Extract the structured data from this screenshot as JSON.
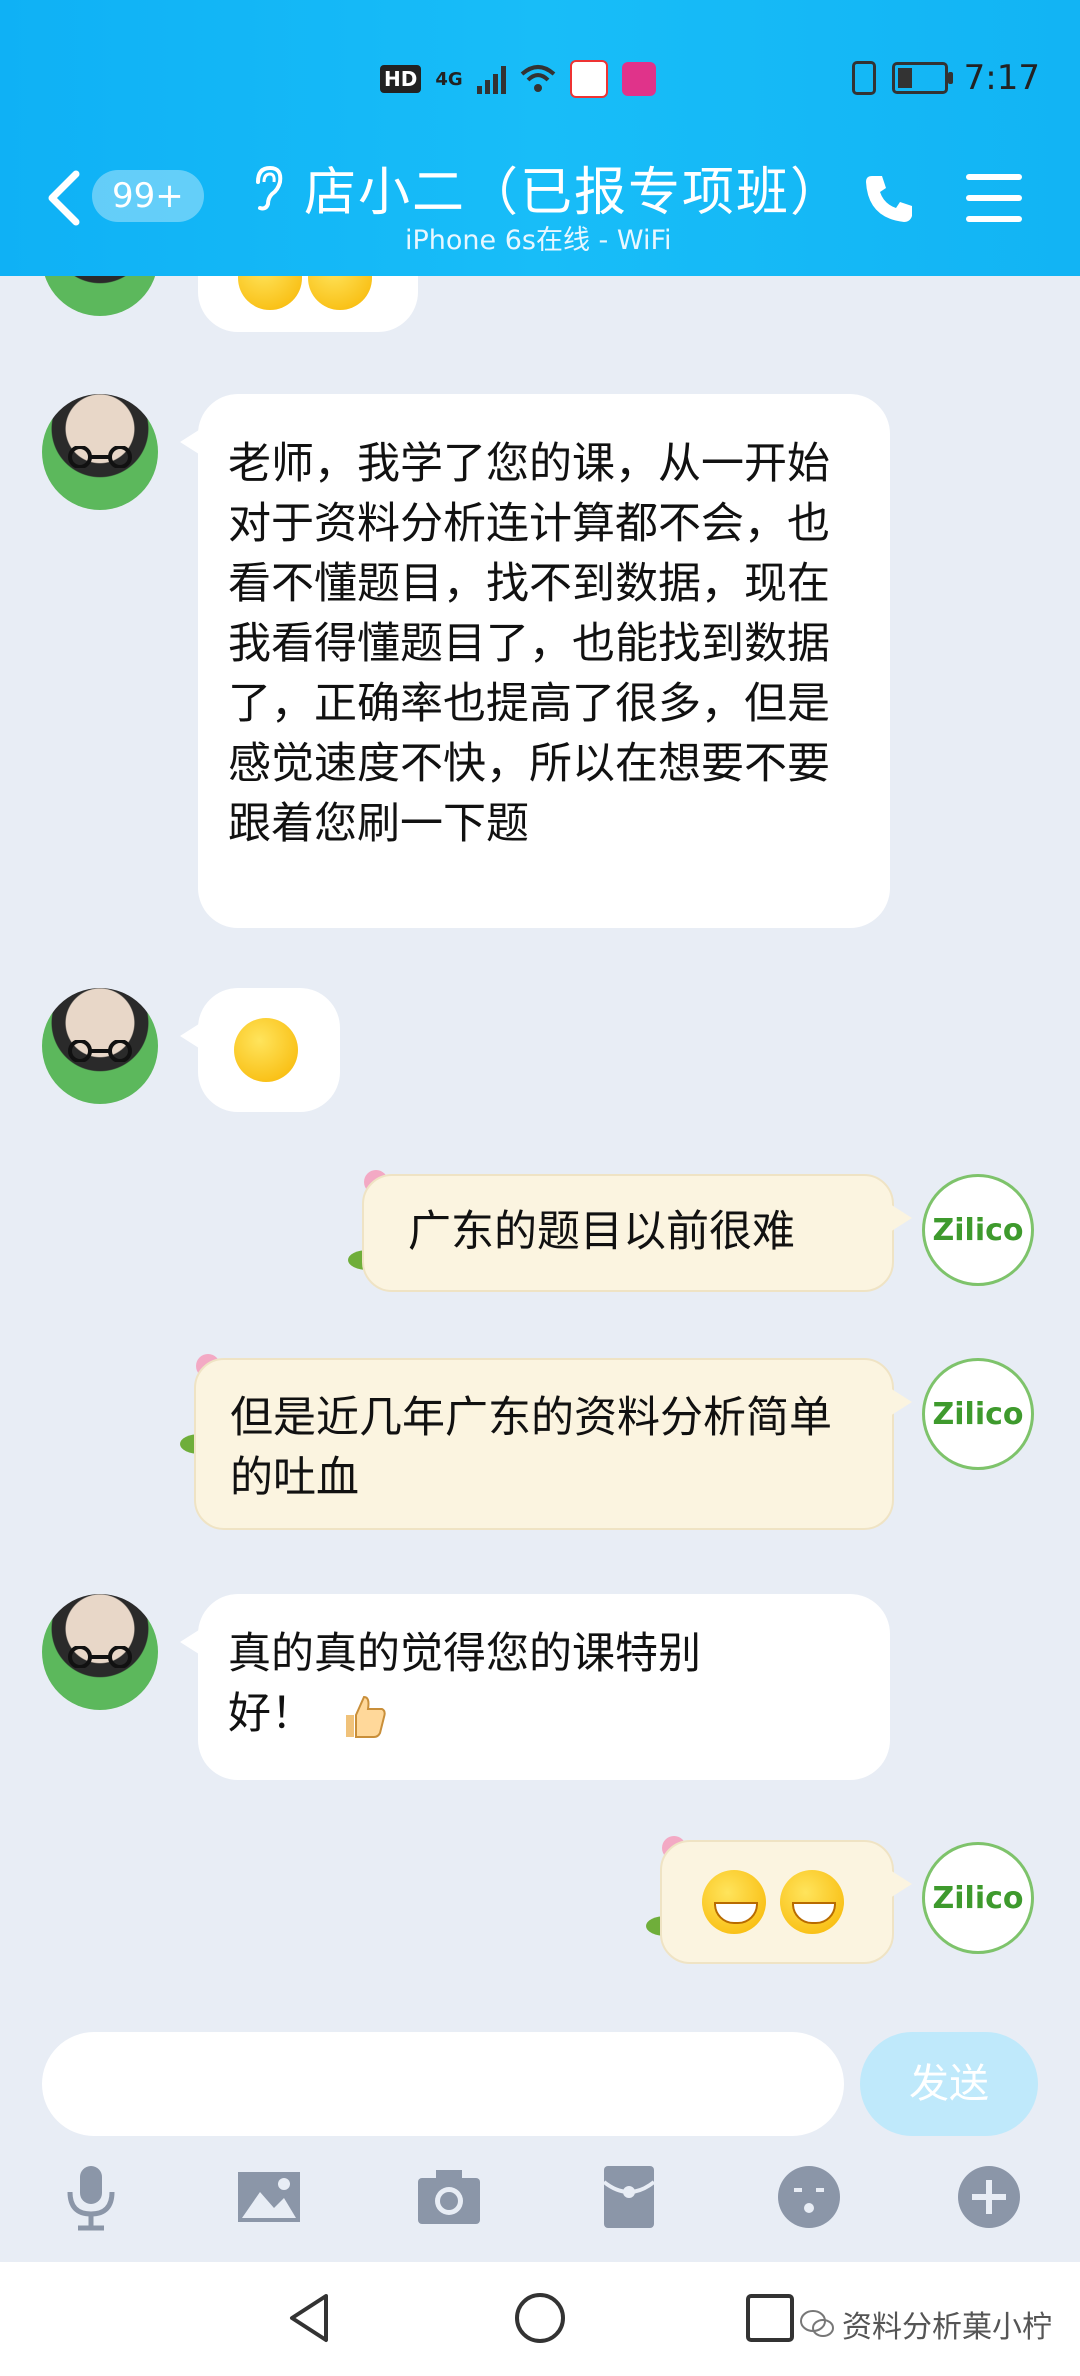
{
  "status_bar": {
    "left_badge": "HD",
    "network": "4G",
    "time": "7:17"
  },
  "header": {
    "unread_count": "99+",
    "title": "店小二（已报专项班）",
    "subtitle": "iPhone 6s在线 - WiFi"
  },
  "messages": [
    {
      "side": "left",
      "text": "老师，我学了您的课，从一开始对于资料分析连计算都不会，也看不懂题目，找不到数据，现在我看得懂题目了，也能找到数据了，正确率也提高了很多，但是感觉速度不快，所以在想要不要跟着您刷一下题"
    },
    {
      "side": "left",
      "emoji": "crying-laughing"
    },
    {
      "side": "right",
      "text": "广东的题目以前很难"
    },
    {
      "side": "right",
      "text": "但是近几年广东的资料分析简单的吐血"
    },
    {
      "side": "left",
      "text": "真的真的觉得您的课特别好！"
    },
    {
      "side": "right",
      "emoji": "grin x2"
    }
  ],
  "my_avatar_text": "Zilico",
  "input": {
    "placeholder": "",
    "send_label": "发送"
  },
  "watermark": "资料分析菓小柠",
  "colors": {
    "header_bg": "#18bdf8",
    "chat_bg": "#e8edf5",
    "my_bubble": "#fbf4e0",
    "send_disabled": "#bfe9fb"
  }
}
